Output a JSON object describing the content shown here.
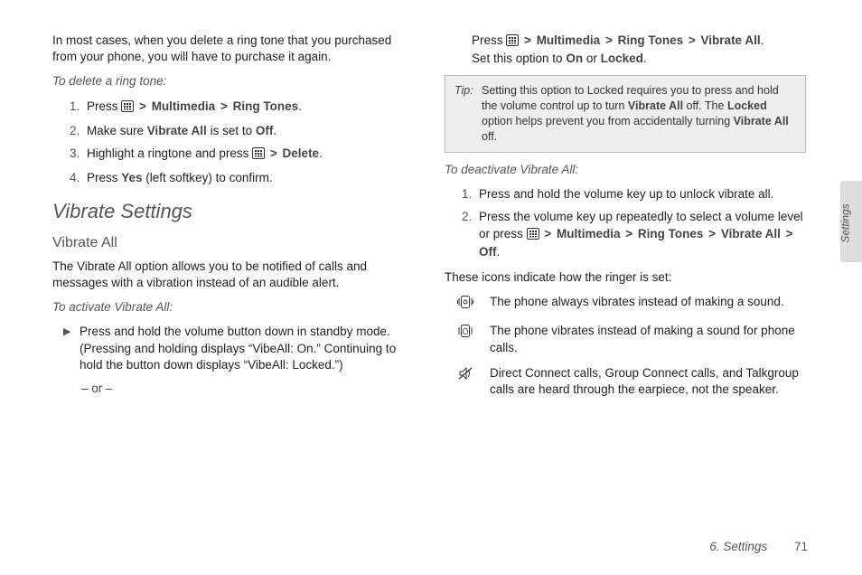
{
  "col1": {
    "intro_p": "In most cases, when you delete a ring tone that you purchased from your phone, you will have to purchase it again.",
    "delete_label": "To delete a ring tone:",
    "step1": {
      "prefix": "Press ",
      "b1": "Multimedia",
      "b2": "Ring Tones",
      "suffix": "."
    },
    "step2": {
      "a": "Make sure ",
      "b1": "Vibrate All",
      "mid": " is set to ",
      "b2": "Off",
      "end": "."
    },
    "step3": {
      "a": "Highlight a ringtone and press ",
      "b1": "Delete",
      "end": "."
    },
    "step4": {
      "a": "Press ",
      "b1": "Yes",
      "end": " (left softkey) to confirm."
    },
    "h1": "Vibrate Settings",
    "h2": "Vibrate All",
    "vib_p": "The Vibrate All option allows you to be notified of calls and messages with a vibration instead of an audible alert.",
    "activate_label": "To activate Vibrate All:",
    "bullet": "Press and hold the volume button down in standby mode. (Pressing and holding displays “VibeAll: On.” Continuing to hold the button down displays “VibeAll: Locked.”)",
    "or": "– or –"
  },
  "col2": {
    "toprow": {
      "a": "Press ",
      "b1": "Multimedia",
      "b2": "Ring Tones",
      "b3": "Vibrate All",
      "end": ".",
      "line2a": "Set this option to ",
      "on": "On",
      "or": " or ",
      "locked": "Locked",
      "end2": "."
    },
    "tip_label": "Tip:",
    "tip_text": {
      "a": "Setting this option to Locked requires you to press and hold the volume control up to turn ",
      "b1": "Vibrate All",
      "mid": " off. The ",
      "b2": "Locked",
      "c": " option helps prevent you from accidentally turning ",
      "b3": "Vibrate All",
      "end": " off."
    },
    "deact_label": "To deactivate Vibrate All:",
    "d1": "Press and hold the volume key up to unlock vibrate all.",
    "d2": {
      "a": "Press the volume key up repeatedly to select a volume level or press ",
      "b1": "Multimedia",
      "b2": "Ring Tones",
      "b3": "Vibrate All",
      "b4": "Off",
      "end": "."
    },
    "icons_p": "These icons indicate how the ringer is set:",
    "irow1": "The phone always vibrates instead of making a sound.",
    "irow2": "The phone vibrates instead of making a sound for phone calls.",
    "irow3": "Direct Connect calls, Group Connect calls, and Talkgroup calls are heard through the earpiece, not the speaker."
  },
  "side_tab": "Settings",
  "footer_section": "6. Settings",
  "footer_page": "71"
}
